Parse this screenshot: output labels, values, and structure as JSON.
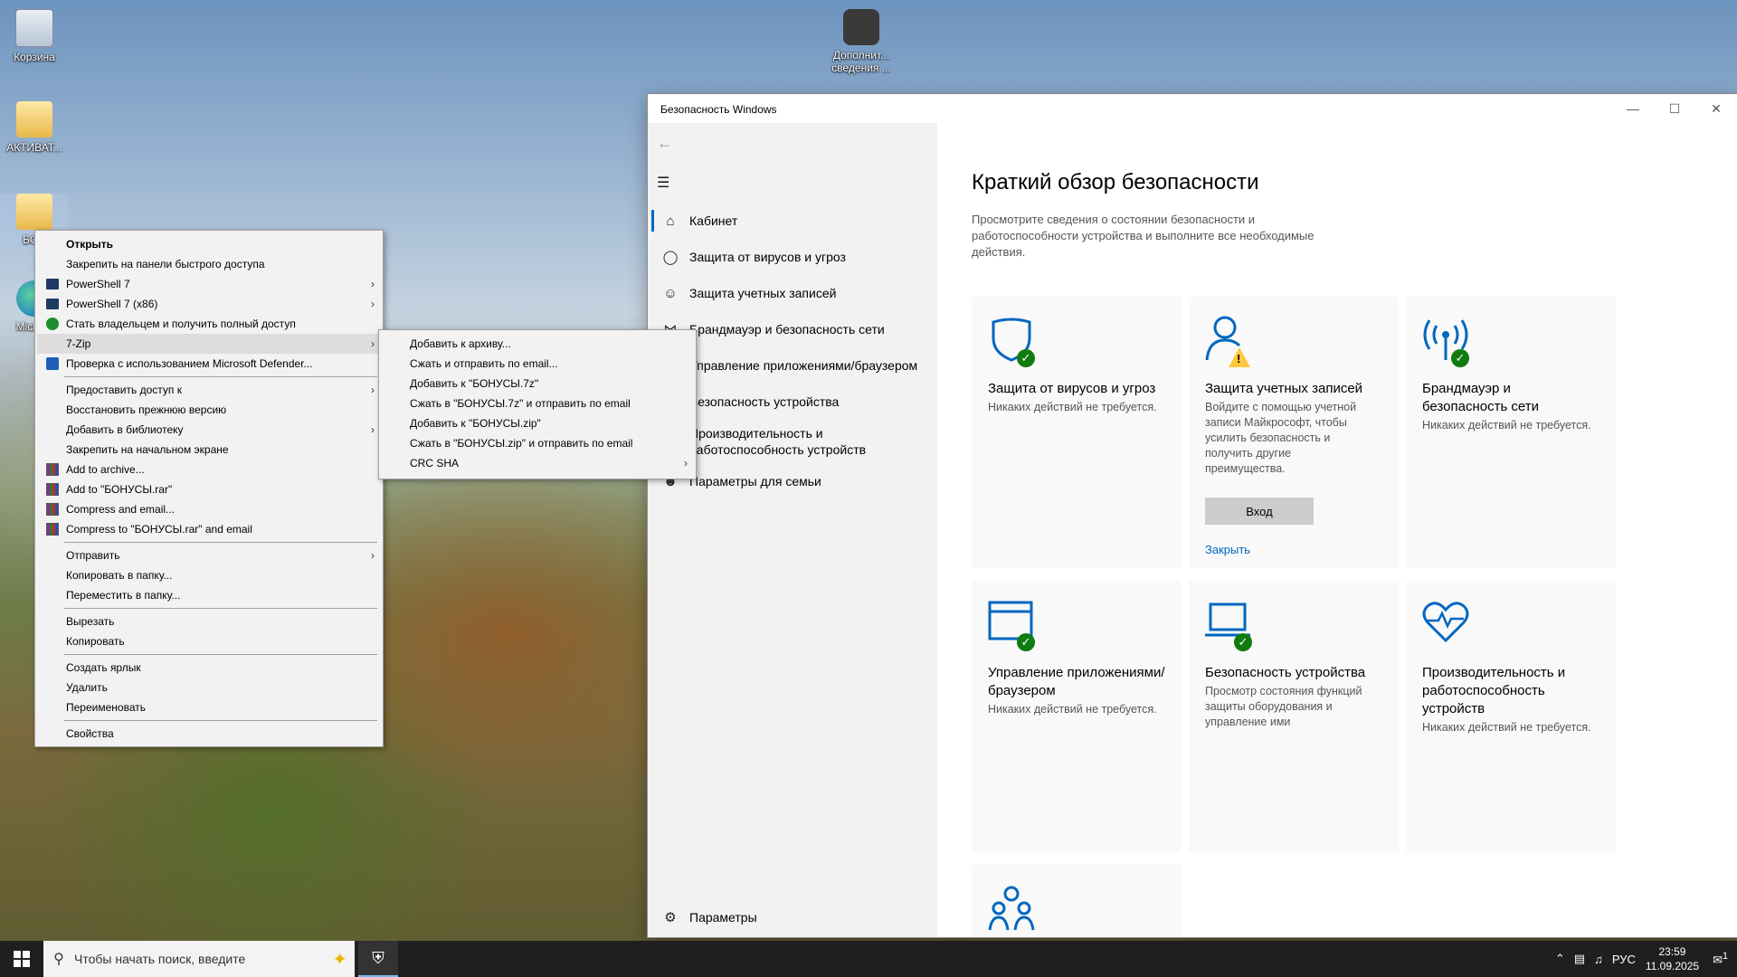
{
  "desktop": {
    "icons": [
      {
        "label": "Корзина"
      },
      {
        "label": "АКТИВАТ..."
      },
      {
        "label": "БОН"
      },
      {
        "label": "Micr Ed"
      },
      {
        "label": "Дополнит... сведения ..."
      }
    ]
  },
  "security_window": {
    "title": "Безопасность Windows",
    "nav": [
      {
        "label": "Кабинет",
        "icon": "home-icon"
      },
      {
        "label": "Защита от вирусов и угроз",
        "icon": "shield-icon"
      },
      {
        "label": "Защита учетных записей",
        "icon": "person-icon"
      },
      {
        "label": "Брандмауэр и безопасность сети",
        "icon": "wifi-icon"
      },
      {
        "label": "Управление приложениями/браузером",
        "icon": "browser-icon"
      },
      {
        "label": "Безопасность устройства",
        "icon": "laptop-icon"
      },
      {
        "label": "Производительность и работоспособность устройств",
        "icon": "heart-icon"
      },
      {
        "label": "Параметры для семьи",
        "icon": "family-icon"
      }
    ],
    "settings_label": "Параметры",
    "heading": "Краткий обзор безопасности",
    "intro": "Просмотрите сведения о состоянии безопасности и работоспособности устройства и выполните все необходимые действия.",
    "tiles": [
      {
        "name": "Защита от вирусов и угроз",
        "desc": "Никаких действий не требуется."
      },
      {
        "name": "Защита учетных записей",
        "desc": "Войдите с помощью учетной записи Майкрософт, чтобы усилить безопасность и получить другие преимущества.",
        "button": "Вход",
        "link": "Закрыть"
      },
      {
        "name": "Брандмауэр и безопасность сети",
        "desc": "Никаких действий не требуется."
      },
      {
        "name": "Управление приложениями/браузером",
        "desc": "Никаких действий не требуется."
      },
      {
        "name": "Безопасность устройства",
        "desc": "Просмотр состояния функций защиты оборудования и управление ими"
      },
      {
        "name": "Производительность и работоспособность устройств",
        "desc": "Никаких действий не требуется."
      }
    ]
  },
  "context_menu": {
    "items": [
      {
        "label": "Открыть"
      },
      {
        "label": "Закрепить на панели быстрого доступа"
      },
      {
        "label": "PowerShell 7"
      },
      {
        "label": "PowerShell 7 (x86)"
      },
      {
        "label": "Стать владельцем и получить полный доступ"
      },
      {
        "label": "7-Zip"
      },
      {
        "label": "Проверка с использованием Microsoft Defender..."
      },
      {
        "label": "Предоставить доступ к"
      },
      {
        "label": "Восстановить прежнюю версию"
      },
      {
        "label": "Добавить в библиотеку"
      },
      {
        "label": "Закрепить на начальном экране"
      },
      {
        "label": "Add to archive..."
      },
      {
        "label": "Add to \"БОНУСЫ.rar\""
      },
      {
        "label": "Compress and email..."
      },
      {
        "label": "Compress to \"БОНУСЫ.rar\" and email"
      },
      {
        "label": "Отправить"
      },
      {
        "label": "Копировать в папку..."
      },
      {
        "label": "Переместить в папку..."
      },
      {
        "label": "Вырезать"
      },
      {
        "label": "Копировать"
      },
      {
        "label": "Создать ярлык"
      },
      {
        "label": "Удалить"
      },
      {
        "label": "Переименовать"
      },
      {
        "label": "Свойства"
      }
    ]
  },
  "zip_submenu": {
    "items": [
      {
        "label": "Добавить к архиву..."
      },
      {
        "label": "Сжать и отправить по email..."
      },
      {
        "label": "Добавить к \"БОНУСЫ.7z\""
      },
      {
        "label": "Сжать в \"БОНУСЫ.7z\" и отправить по email"
      },
      {
        "label": "Добавить к \"БОНУСЫ.zip\""
      },
      {
        "label": "Сжать в \"БОНУСЫ.zip\" и отправить по email"
      },
      {
        "label": "CRC SHA"
      }
    ]
  },
  "taskbar": {
    "search_placeholder": "Чтобы начать поиск, введите",
    "language": "РУС",
    "time": "23:59",
    "date": "11.09.2025",
    "notifications": "1"
  }
}
